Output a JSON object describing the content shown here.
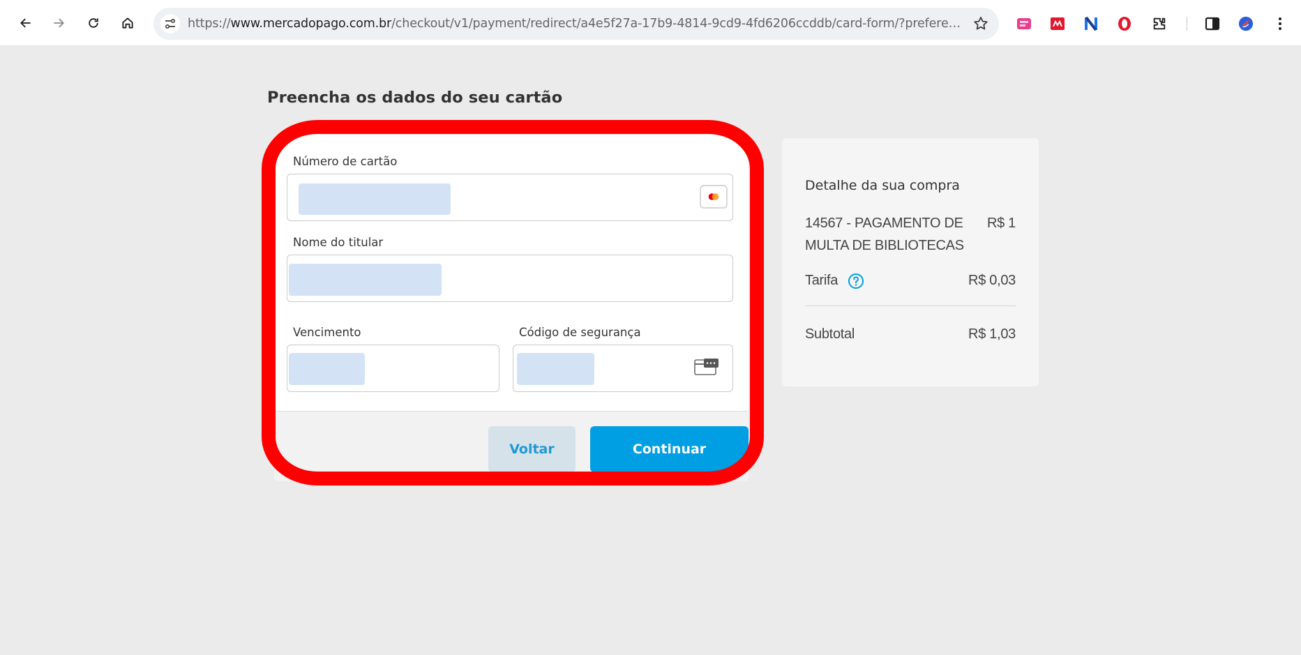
{
  "browser": {
    "url_scheme": "https://",
    "url_host": "www.mercadopago.com.br",
    "url_path": "/checkout/v1/payment/redirect/a4e5f27a-17b9-4814-9cd9-4fd6206ccddb/card-form/?preference...",
    "icons": [
      "back-arrow-icon",
      "forward-arrow-icon",
      "reload-icon",
      "home-icon",
      "site-info-icon",
      "bookmark-star-icon",
      "extension-icon",
      "side-panel-icon",
      "profile-icon",
      "menu-dots-icon"
    ]
  },
  "page": {
    "title": "Preencha os dados do seu cartão"
  },
  "form": {
    "card_number_label": "Número de cartão",
    "holder_name_label": "Nome do titular",
    "expiry_label": "Vencimento",
    "security_code_label": "Código de segurança",
    "back_label": "Voltar",
    "continue_label": "Continuar"
  },
  "summary": {
    "title": "Detalhe da sua compra",
    "item_line1": "14567 - PAGAMENTO DE",
    "item_line2": "MULTA DE BIBLIOTECAS",
    "item_price": "R$ 1",
    "fee_label": "Tarifa",
    "fee_value": "R$ 0,03",
    "subtotal_label": "Subtotal",
    "subtotal_value": "R$ 1,03"
  },
  "colors": {
    "primary": "#009ee3",
    "highlight": "#ff0000",
    "autofill": "#d3e3f5",
    "page_bg": "#ebebeb"
  }
}
